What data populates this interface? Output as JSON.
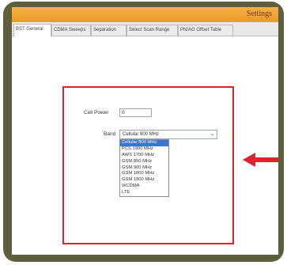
{
  "window": {
    "title": "Settings"
  },
  "tabs": [
    {
      "label": "BST General",
      "active": true
    },
    {
      "label": "CDMA Sweeps",
      "active": false
    },
    {
      "label": "Separation",
      "active": false
    },
    {
      "label": "Select Scan Range",
      "active": false
    },
    {
      "label": "PN/AG Offset Table",
      "active": false
    }
  ],
  "form": {
    "cell_power_label": "Cell Power",
    "cell_power_value": "0",
    "band_label": "Band",
    "band_selected": "Cellular 800 MHz",
    "band_options": [
      "Cellular 800 MHz",
      "PCS 1900 MHz",
      "AWS 1700 MHz",
      "GSM 850 MHz",
      "GSM 900 MHz",
      "GSM 1800 MHz",
      "GSM 1900 MHz",
      "WCDMA",
      "LTE"
    ]
  },
  "colors": {
    "frame": "#5e5f3c",
    "titlebar": "#ec9a24",
    "highlight": "#e0222c",
    "selected_option": "#3875d7"
  },
  "icons": {
    "select_arrow": "chevron-down-icon",
    "pointer": "arrow-left-icon"
  }
}
